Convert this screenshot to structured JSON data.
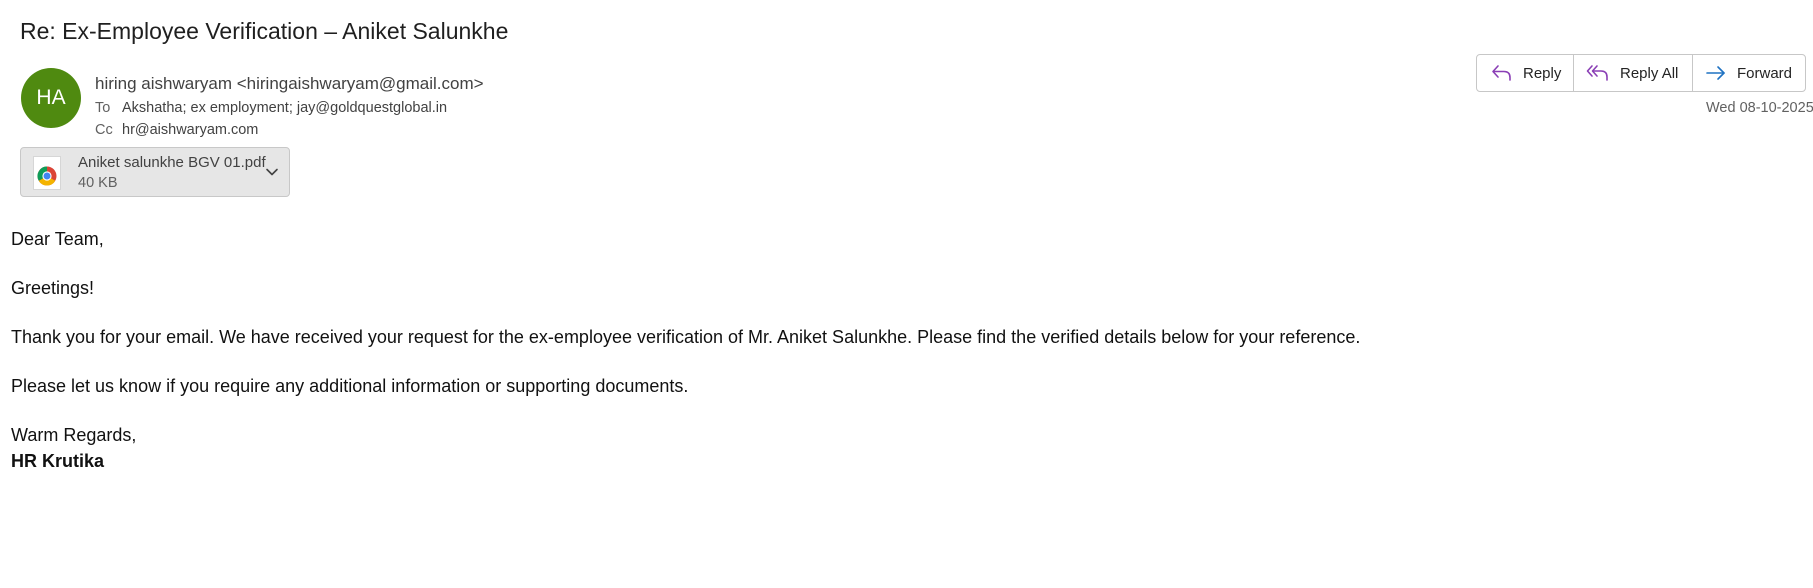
{
  "email": {
    "subject": "Re: Ex-Employee Verification – Aniket Salunkhe",
    "avatar_initials": "HA",
    "avatar_color": "#4f8a10",
    "sender": "hiring aishwaryam <hiringaishwaryam@gmail.com>",
    "to_label": "To",
    "to": "Akshatha; ex employment; jay@goldquestglobal.in",
    "cc_label": "Cc",
    "cc": "hr@aishwaryam.com",
    "date": "Wed 08-10-2025"
  },
  "attachment": {
    "name": "Aniket salunkhe BGV 01.pdf",
    "size": "40 KB",
    "icon": "chrome-icon"
  },
  "actions": {
    "reply_label": "Reply",
    "reply_all_label": "Reply All",
    "forward_label": "Forward",
    "reply_icon_color": "#8a3fb5",
    "forward_icon_color": "#1f72c2"
  },
  "body": {
    "greeting": "Dear Team,",
    "line1": "Greetings!",
    "line2": "Thank you for your email. We have received your request for the ex-employee verification of Mr. Aniket Salunkhe. Please find the verified details below for your reference.",
    "line3": "Please let us know if you require any additional information or supporting documents.",
    "closing": "Warm Regards,",
    "signature": "HR Krutika"
  }
}
